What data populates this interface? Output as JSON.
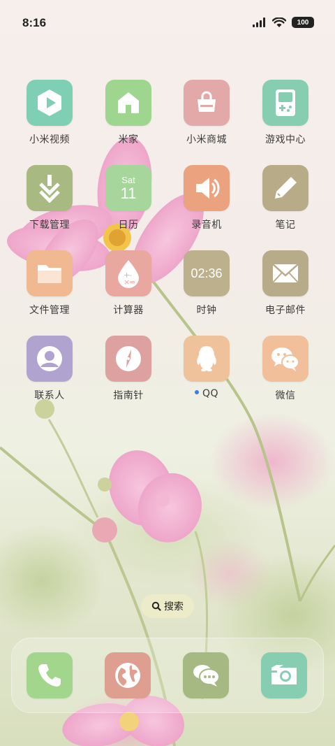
{
  "status": {
    "time": "8:16",
    "battery": "100"
  },
  "apps": [
    {
      "id": "mi-video",
      "label": "小米视频",
      "icon": "play-hexagon-icon",
      "color": "#7ecfb4"
    },
    {
      "id": "mi-home",
      "label": "米家",
      "icon": "house-icon",
      "color": "#9fd68f"
    },
    {
      "id": "mi-store",
      "label": "小米商城",
      "icon": "shopping-bag-icon",
      "color": "#e3a9a9"
    },
    {
      "id": "game-center",
      "label": "游戏中心",
      "icon": "gamepad-icon",
      "color": "#86cdb1"
    },
    {
      "id": "downloads",
      "label": "下载管理",
      "icon": "download-arrow-icon",
      "color": "#a9b982"
    },
    {
      "id": "calendar",
      "label": "日历",
      "icon": "calendar-icon",
      "color": "#a6d69b",
      "day": "Sat",
      "date": "11"
    },
    {
      "id": "recorder",
      "label": "录音机",
      "icon": "speaker-icon",
      "color": "#eba27e"
    },
    {
      "id": "notes",
      "label": "笔记",
      "icon": "pen-icon",
      "color": "#b8ab88"
    },
    {
      "id": "file-manager",
      "label": "文件管理",
      "icon": "folder-icon",
      "color": "#f1b991"
    },
    {
      "id": "calculator",
      "label": "计算器",
      "icon": "calculator-drop-icon",
      "color": "#e8a8a0"
    },
    {
      "id": "clock",
      "label": "时钟",
      "icon": "clock-icon",
      "color": "#bcb08d",
      "display": "02:36"
    },
    {
      "id": "email",
      "label": "电子邮件",
      "icon": "envelope-icon",
      "color": "#b7ab8a"
    },
    {
      "id": "contacts",
      "label": "联系人",
      "icon": "person-icon",
      "color": "#b0a3cf"
    },
    {
      "id": "compass",
      "label": "指南针",
      "icon": "compass-icon",
      "color": "#dda29f"
    },
    {
      "id": "qq",
      "label": "QQ",
      "icon": "qq-penguin-icon",
      "color": "#f0c29c",
      "notified": true
    },
    {
      "id": "wechat",
      "label": "微信",
      "icon": "wechat-icon",
      "color": "#f1bf99"
    }
  ],
  "search": {
    "label": "搜索"
  },
  "dock": [
    {
      "id": "phone",
      "icon": "phone-icon",
      "color": "#a3d68d"
    },
    {
      "id": "browser",
      "icon": "globe-icon",
      "color": "#de9e90"
    },
    {
      "id": "messages",
      "icon": "chat-bubbles-icon",
      "color": "#a7b982"
    },
    {
      "id": "camera",
      "icon": "camera-icon",
      "color": "#86cdb1"
    }
  ]
}
